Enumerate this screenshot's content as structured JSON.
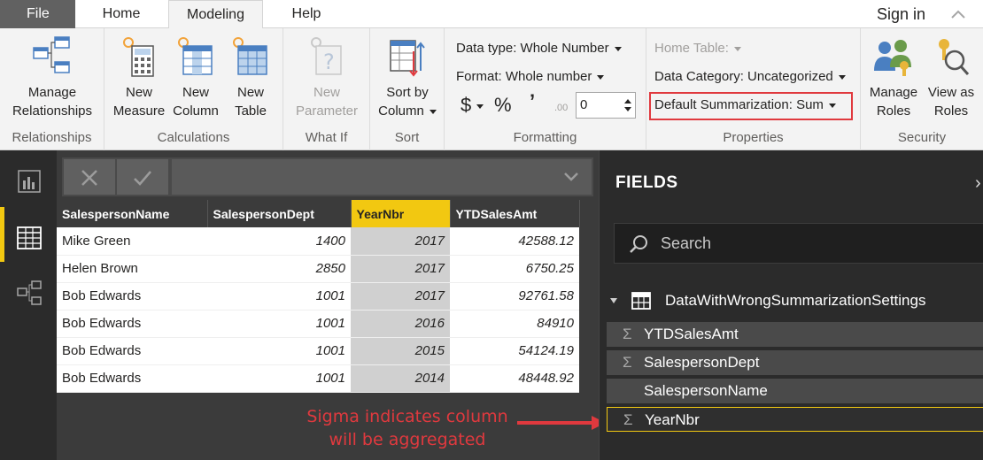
{
  "tabs": {
    "file": "File",
    "home": "Home",
    "modeling": "Modeling",
    "help": "Help",
    "signin": "Sign in"
  },
  "ribbon": {
    "relationships": {
      "manage_l1": "Manage",
      "manage_l2": "Relationships",
      "group": "Relationships"
    },
    "calculations": {
      "measure_l1": "New",
      "measure_l2": "Measure",
      "column_l1": "New",
      "column_l2": "Column",
      "table_l1": "New",
      "table_l2": "Table",
      "group": "Calculations"
    },
    "whatif": {
      "param_l1": "New",
      "param_l2": "Parameter",
      "group": "What If"
    },
    "sort": {
      "l1": "Sort by",
      "l2": "Column",
      "group": "Sort"
    },
    "formatting": {
      "data_type": "Data type: Whole Number",
      "format": "Format: Whole number",
      "currency": "$",
      "percent": "%",
      "comma": "’",
      "decimals_icon": ".00",
      "decimals_value": "0",
      "group": "Formatting"
    },
    "properties": {
      "home_table": "Home Table:",
      "data_category": "Data Category: Uncategorized",
      "default_summarization": "Default Summarization: Sum",
      "group": "Properties"
    },
    "security": {
      "roles_l1": "Manage",
      "roles_l2": "Roles",
      "view_l1": "View as",
      "view_l2": "Roles",
      "group": "Security"
    }
  },
  "table": {
    "columns": [
      "SalespersonName",
      "SalespersonDept",
      "YearNbr",
      "YTDSalesAmt"
    ],
    "rows": [
      [
        "Mike Green",
        "1400",
        "2017",
        "42588.12"
      ],
      [
        "Helen Brown",
        "2850",
        "2017",
        "6750.25"
      ],
      [
        "Bob Edwards",
        "1001",
        "2017",
        "92761.58"
      ],
      [
        "Bob Edwards",
        "1001",
        "2016",
        "84910"
      ],
      [
        "Bob Edwards",
        "1001",
        "2015",
        "54124.19"
      ],
      [
        "Bob Edwards",
        "1001",
        "2014",
        "48448.92"
      ]
    ]
  },
  "annotation": {
    "line1": "Sigma indicates column",
    "line2": "will be aggregated"
  },
  "fields": {
    "title": "FIELDS",
    "search_placeholder": "Search",
    "table_name": "DataWithWrongSummarizationSettings",
    "sigma": "Σ",
    "items": [
      {
        "name": "YTDSalesAmt",
        "sigma": true
      },
      {
        "name": "SalespersonDept",
        "sigma": true
      },
      {
        "name": "SalespersonName",
        "sigma": false
      },
      {
        "name": "YearNbr",
        "sigma": true
      }
    ]
  },
  "colors": {
    "accent_yellow": "#f2c811",
    "highlight_red": "#e0393e"
  }
}
